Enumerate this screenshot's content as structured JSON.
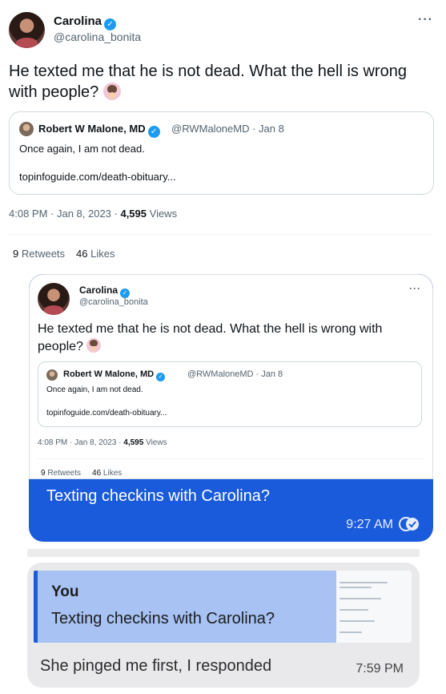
{
  "tweet": {
    "author_name": "Carolina",
    "author_handle": "@carolina_bonita",
    "text": "He texted me that he is not dead. What the hell is wrong with people?",
    "quote": {
      "author_name": "Robert W Malone, MD",
      "author_handle": "@RWMaloneMD · Jan 8",
      "text": "Once again, I am not dead.",
      "link": "topinfoguide.com/death-obituary..."
    },
    "time": "4:08 PM · Jan 8, 2023 · ",
    "views_count": "4,595",
    "views_label": " Views",
    "retweets_count": "9",
    "retweets_label": " Retweets",
    "likes_count": "46",
    "likes_label": " Likes"
  },
  "embedded_tweet": {
    "author_name": "Carolina",
    "author_handle": "@carolina_bonita",
    "text": "He texted me that he is not dead. What the hell is wrong with people?",
    "quote": {
      "author_name": "Robert W Malone, MD",
      "author_handle": "@RWMaloneMD · Jan 8",
      "text": "Once again, I am not dead.",
      "link": "topinfoguide.com/death-obituary..."
    },
    "time": "4:08 PM · Jan 8, 2023 · ",
    "views_count": "4,595",
    "views_label": " Views",
    "retweets_count": "9",
    "retweets_label": " Retweets",
    "likes_count": "46",
    "likes_label": " Likes"
  },
  "chat": {
    "sent_message": "Texting checkins with Carolina?",
    "sent_time": "9:27 AM",
    "reply_quote_author": "You",
    "reply_quote_text": "Texting checkins with Carolina?",
    "received_message": "She pinged me first, I responded",
    "received_time": "7:59 PM"
  },
  "colors": {
    "twitter_blue": "#1d9bf0",
    "chat_blue": "#1a5bdc",
    "reply_quote_bg": "#a7c2f3",
    "gray_bubble": "#e9e9eb"
  },
  "icons": [
    "verified-badge-icon",
    "more-options-icon",
    "emoji-facepalm-icon",
    "read-receipt-icon"
  ]
}
